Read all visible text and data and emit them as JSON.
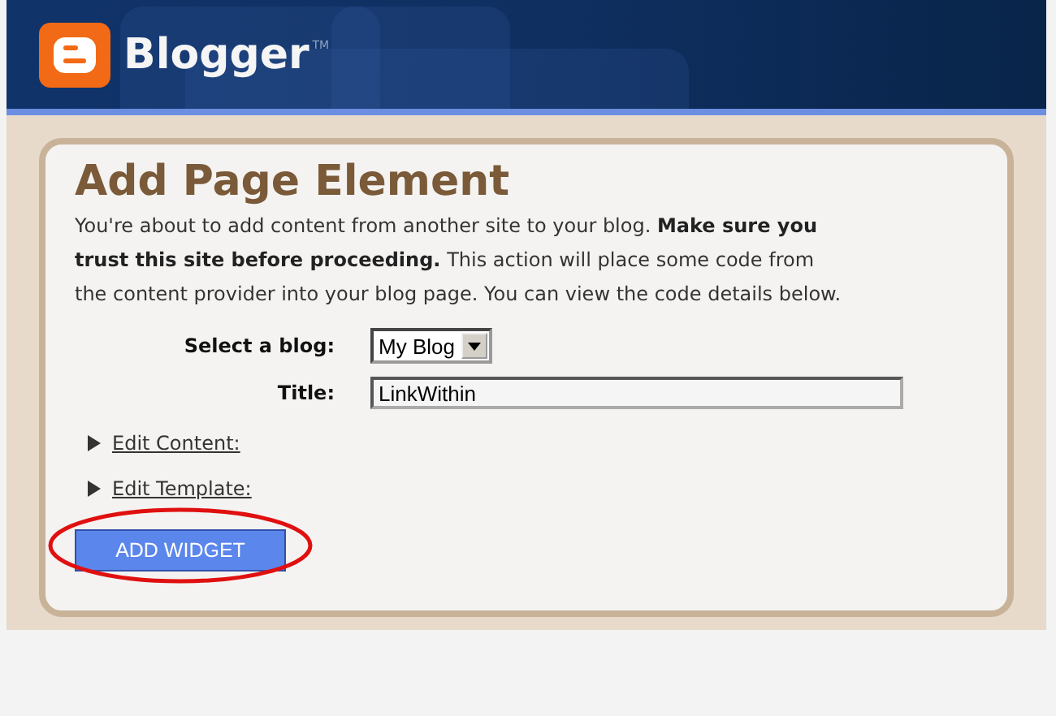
{
  "header": {
    "logo_text": "Blogger",
    "trademark": "TM"
  },
  "panel": {
    "title": "Add Page Element",
    "description": "You're about to add content from another site to your blog. **Make sure you trust this site before proceeding.** This action will place some code from the content provider into your blog page. You can view the code details below.",
    "fields": [
      {
        "kind": "select",
        "label": "Select a blog:",
        "value": "My Blog"
      },
      {
        "kind": "text",
        "label": "Title:",
        "value": "LinkWithin"
      }
    ],
    "sections": [
      {
        "label": "Edit Content:",
        "expanded": false
      },
      {
        "label": "Edit Template:",
        "expanded": false
      }
    ],
    "button": {
      "label": "ADD WIDGET",
      "highlighted": true
    }
  }
}
